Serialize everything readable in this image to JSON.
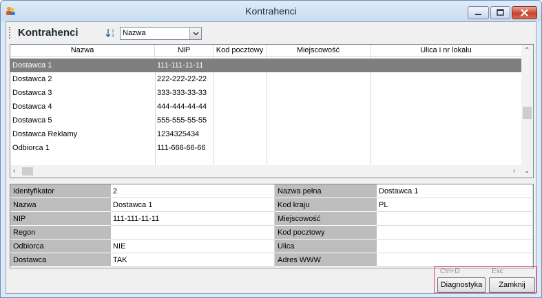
{
  "window": {
    "title": "Kontrahenci"
  },
  "toolbar": {
    "title": "Kontrahenci",
    "sort_value": "Nazwa"
  },
  "grid": {
    "columns": [
      "Nazwa",
      "NIP",
      "Kod pocztowy",
      "Miejscowość",
      "Ulica i nr lokalu"
    ],
    "rows": [
      [
        "Dostawca 1",
        "111-111-11-11",
        "",
        "",
        ""
      ],
      [
        "Dostawca 2",
        "222-222-22-22",
        "",
        "",
        ""
      ],
      [
        "Dostawca 3",
        "333-333-33-33",
        "",
        "",
        ""
      ],
      [
        "Dostawca 4",
        "444-444-44-44",
        "",
        "",
        ""
      ],
      [
        "Dostawca 5",
        "555-555-55-55",
        "",
        "",
        ""
      ],
      [
        "Dostawca Reklamy",
        "1234325434",
        "",
        "",
        ""
      ],
      [
        "Odbiorca 1",
        "111-666-66-66",
        "",
        "",
        ""
      ]
    ],
    "selected_row": 0
  },
  "details": {
    "left": [
      {
        "label": "Identyfikator",
        "value": "2"
      },
      {
        "label": "Nazwa",
        "value": "Dostawca 1"
      },
      {
        "label": "NIP",
        "value": "111-111-11-11"
      },
      {
        "label": "Regon",
        "value": ""
      },
      {
        "label": "Odbiorca",
        "value": "NIE"
      },
      {
        "label": "Dostawca",
        "value": "TAK"
      }
    ],
    "right": [
      {
        "label": "Nazwa pełna",
        "value": "Dostawca 1"
      },
      {
        "label": "Kod kraju",
        "value": "PL"
      },
      {
        "label": "Miejscowość",
        "value": ""
      },
      {
        "label": "Kod pocztowy",
        "value": ""
      },
      {
        "label": "Ulica",
        "value": ""
      },
      {
        "label": "Adres WWW",
        "value": ""
      }
    ]
  },
  "footer": {
    "diag_hint": "Ctrl+D",
    "diag_label": "Diagnostyka",
    "close_hint": "Esc",
    "close_label": "Zamknij"
  },
  "colors": {
    "selected_row": "#7f7f7f",
    "label_bg": "#bdbdbd",
    "highlight_box": "#e0457a"
  }
}
